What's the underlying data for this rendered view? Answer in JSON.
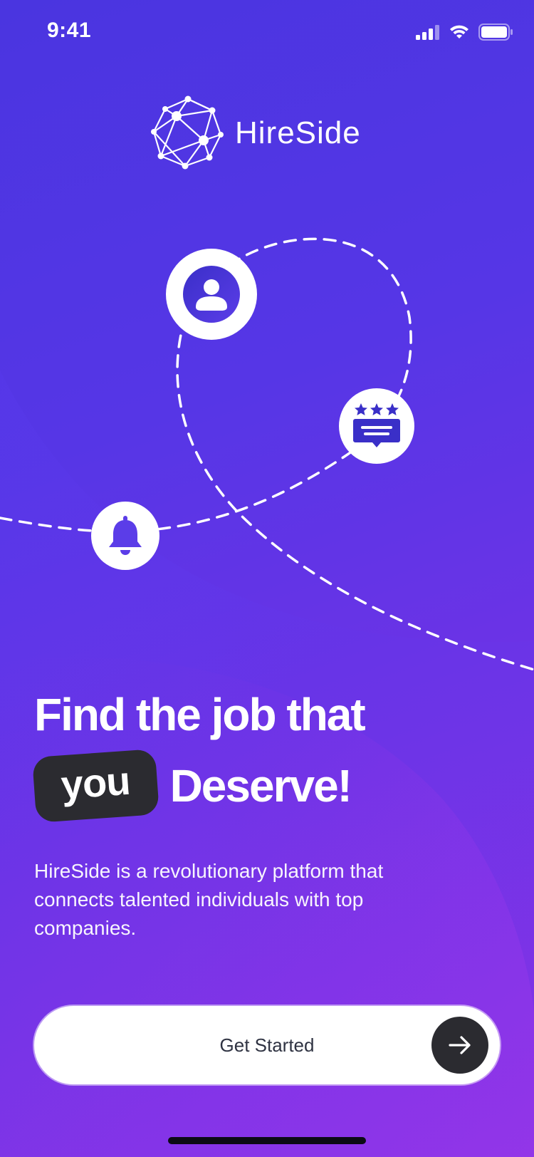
{
  "status_bar": {
    "time": "9:41",
    "icons": [
      "cellular-signal-icon",
      "wifi-icon",
      "battery-icon"
    ]
  },
  "logo": {
    "name": "HireSide",
    "icon": "network-globe-icon"
  },
  "illustration": {
    "icons": [
      "user-icon",
      "review-stars-icon",
      "bell-icon"
    ]
  },
  "headline": {
    "line1": "Find the job that",
    "highlight": "you",
    "line2_rest": "Deserve!"
  },
  "description": "HireSide is a revolutionary platform that connects talented individuals with top companies.",
  "cta": {
    "label": "Get Started",
    "icon": "arrow-right-icon"
  },
  "colors": {
    "gradient_start": "#4a35e0",
    "gradient_end": "#8a32e6",
    "dark": "#2b2b30",
    "icon_accent": "#3a2fc8",
    "bell_accent": "#5b3de8",
    "white": "#ffffff"
  }
}
